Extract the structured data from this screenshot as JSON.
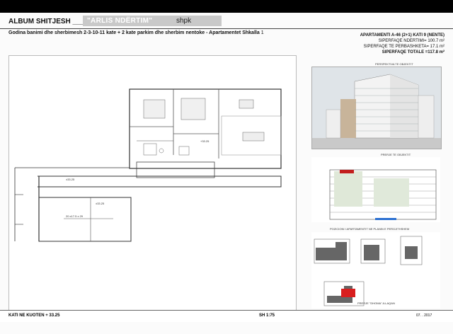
{
  "header": {
    "album_title": "ALBUM SHITJESH ____",
    "company_name": "\"ARLIS NDËRTIM\"",
    "company_suffix": "shpk",
    "subtitle": "Godina  banimi dhe sherbimesh 2-3-10-11 kate + 2 kate parkim  dhe sherbim nentoke - Apartamentet Shkalla",
    "subtitle_suffix": "1"
  },
  "apartment": {
    "line1": "APARTAMENTI  A-46  (2+1) KATI 9 (NENTE)",
    "line2": "SIPERFAQE NDERTIMI= 100.7 m²",
    "line3": "SIPERFAQE TE PERBASHKETA= 17.1 m²",
    "line4": "SIPERFAQE TOTALE =117.8 m²"
  },
  "plan": {
    "stair_label": "20 x17.5 x 29",
    "level_mark_1": "±33.25",
    "level_mark_2": "±33.25",
    "level_mark_3": "+33.25"
  },
  "side": {
    "perspective_caption": "PERSPEKTIVA TE OBJEKTIT",
    "section_caption": "PRERJE TE OBJEKTIT",
    "position_caption": "POZICIONI I APARTAMENTIT NE PLANIN E PERGJITHSHEM",
    "block_caption": "PRERJE \"DHOMA\"-ILLAQAN"
  },
  "footer": {
    "level": "KATI NE KUOTEN + 33.25",
    "scale": "SH 1:75",
    "date": "07. . 2017"
  },
  "colors": {
    "highlight": "#d81e1e",
    "sheet": "#fbfbfb",
    "company_band": "#c9c9c9"
  }
}
